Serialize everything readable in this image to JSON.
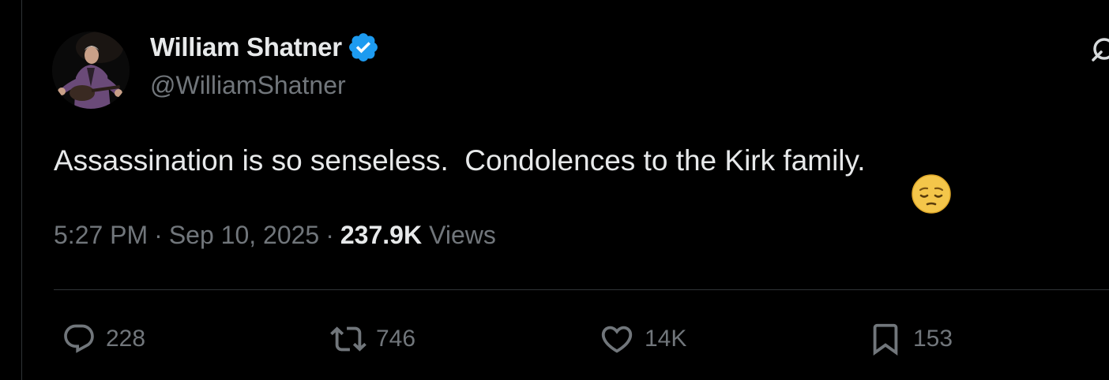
{
  "author": {
    "display_name": "William Shatner",
    "handle": "@WilliamShatner",
    "verified": true,
    "verified_badge_color": "#1d9bf0",
    "avatar_icon": "guitar-player-avatar"
  },
  "tweet": {
    "text": "Assassination is so senseless.  Condolences to the Kirk family.",
    "emoji": "pensive-face-emoji"
  },
  "meta": {
    "time": "5:27 PM",
    "separator": "·",
    "date": "Sep 10, 2025",
    "views_count": "237.9K",
    "views_label": "Views"
  },
  "actions": {
    "reply": {
      "icon": "reply-bubble-icon",
      "count": "228"
    },
    "repost": {
      "icon": "repost-icon",
      "count": "746"
    },
    "like": {
      "icon": "heart-icon",
      "count": "14K"
    },
    "bookmark": {
      "icon": "bookmark-icon",
      "count": "153"
    }
  },
  "colors": {
    "background": "#000000",
    "primary_text": "#e7e9ea",
    "secondary_text": "#71767b",
    "divider": "#2f3336"
  }
}
